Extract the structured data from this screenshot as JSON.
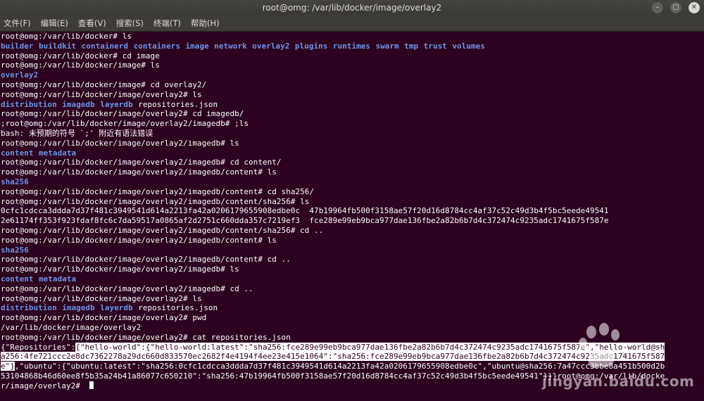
{
  "window": {
    "title": "root@omg: /var/lib/docker/image/overlay2"
  },
  "menu": [
    "文件(F)",
    "编辑(E)",
    "查看(V)",
    "搜索(S)",
    "终端(T)",
    "帮助(H)"
  ],
  "terminal": {
    "lines": [
      {
        "segments": [
          {
            "text": "root@omg:/var/lib/docker# ls"
          }
        ]
      },
      {
        "segments": [
          {
            "text": "builder",
            "type": "dir"
          },
          {
            "text": "buildkit",
            "type": "dir"
          },
          {
            "text": "containerd",
            "type": "dir"
          },
          {
            "text": "containers",
            "type": "dir"
          },
          {
            "text": "image",
            "type": "dir"
          },
          {
            "text": "network",
            "type": "dir"
          },
          {
            "text": "overlay2",
            "type": "dir"
          },
          {
            "text": "plugins",
            "type": "dir"
          },
          {
            "text": "runtimes",
            "type": "dir"
          },
          {
            "text": "swarm",
            "type": "dir"
          },
          {
            "text": "tmp",
            "type": "dir"
          },
          {
            "text": "trust",
            "type": "dir"
          },
          {
            "text": "volumes",
            "type": "dir"
          }
        ]
      },
      {
        "segments": [
          {
            "text": "root@omg:/var/lib/docker# cd image"
          }
        ]
      },
      {
        "segments": [
          {
            "text": "root@omg:/var/lib/docker/image# ls"
          }
        ]
      },
      {
        "segments": [
          {
            "text": "overlay2",
            "type": "dir"
          }
        ]
      },
      {
        "segments": [
          {
            "text": "root@omg:/var/lib/docker/image# cd overlay2/"
          }
        ]
      },
      {
        "segments": [
          {
            "text": "root@omg:/var/lib/docker/image/overlay2# ls"
          }
        ]
      },
      {
        "segments": [
          {
            "text": "distribution",
            "type": "dir"
          },
          {
            "text": "imagedb",
            "type": "dir"
          },
          {
            "text": "layerdb",
            "type": "dir"
          },
          {
            "text": "repositories.json"
          }
        ]
      },
      {
        "segments": [
          {
            "text": "root@omg:/var/lib/docker/image/overlay2# cd imagedb/"
          }
        ]
      },
      {
        "segments": [
          {
            "text": ";root@omg:/var/lib/docker/image/overlay2/imagedb# ;ls"
          }
        ]
      },
      {
        "segments": [
          {
            "text": "bash: 未预期的符号 `;' 附近有语法错误"
          }
        ]
      },
      {
        "segments": [
          {
            "text": "root@omg:/var/lib/docker/image/overlay2/imagedb# ls"
          }
        ]
      },
      {
        "segments": [
          {
            "text": "content",
            "type": "dir"
          },
          {
            "text": "metadata",
            "type": "dir"
          }
        ]
      },
      {
        "segments": [
          {
            "text": "root@omg:/var/lib/docker/image/overlay2/imagedb# cd content/"
          }
        ]
      },
      {
        "segments": [
          {
            "text": "root@omg:/var/lib/docker/image/overlay2/imagedb/content# ls"
          }
        ]
      },
      {
        "segments": [
          {
            "text": "sha256",
            "type": "dir"
          }
        ]
      },
      {
        "segments": [
          {
            "text": "root@omg:/var/lib/docker/image/overlay2/imagedb/content# cd sha256/"
          }
        ]
      },
      {
        "segments": [
          {
            "text": "root@omg:/var/lib/docker/image/overlay2/imagedb/content/sha256# ls"
          }
        ]
      },
      {
        "segments": [
          {
            "text": "0cfc1cdcca3ddda7d37f481c3949541d614a2213fa42a0206179655908edbe0c  47b19964fb500f3158ae57f20d16d8784cc4af37c52c49d3b4f5bc5eede49541"
          }
        ]
      },
      {
        "segments": [
          {
            "text": "2e61174ff353f923fdaf8fc6c7da59517a0865af2d2751c660dda357c7219ef3  fce289e99eb9bca977dae136fbe2a82b6b7d4c372474c9235adc1741675f587e"
          }
        ]
      },
      {
        "segments": [
          {
            "text": "root@omg:/var/lib/docker/image/overlay2/imagedb/content/sha256# cd .."
          }
        ]
      },
      {
        "segments": [
          {
            "text": "root@omg:/var/lib/docker/image/overlay2/imagedb/content# ls"
          }
        ]
      },
      {
        "segments": [
          {
            "text": "sha256",
            "type": "dir"
          }
        ]
      },
      {
        "segments": [
          {
            "text": "root@omg:/var/lib/docker/image/overlay2/imagedb/content# cd .."
          }
        ]
      },
      {
        "segments": [
          {
            "text": "root@omg:/var/lib/docker/image/overlay2/imagedb# ls"
          }
        ]
      },
      {
        "segments": [
          {
            "text": "content",
            "type": "dir"
          },
          {
            "text": "metadata",
            "type": "dir"
          }
        ]
      },
      {
        "segments": [
          {
            "text": "root@omg:/var/lib/docker/image/overlay2/imagedb# cd .."
          }
        ]
      },
      {
        "segments": [
          {
            "text": "root@omg:/var/lib/docker/image/overlay2# ls"
          }
        ]
      },
      {
        "segments": [
          {
            "text": "distribution",
            "type": "dir"
          },
          {
            "text": "imagedb",
            "type": "dir"
          },
          {
            "text": "layerdb",
            "type": "dir"
          },
          {
            "text": "repositories.json"
          }
        ]
      },
      {
        "segments": [
          {
            "text": "root@omg:/var/lib/docker/image/overlay2# pwd"
          }
        ]
      },
      {
        "segments": [
          {
            "text": "/var/lib/docker/image/overlay2"
          }
        ]
      },
      {
        "segments": [
          {
            "text": "root@omg:/var/lib/docker/image/overlay2# cat repositories.json"
          }
        ]
      },
      {
        "segments": [
          {
            "text": "{\"Repositories\":"
          },
          {
            "text": "{\"hello-world\":{\"hello-world:latest\":\"sha256:fce289e99eb9bca977dae136fbe2a82b6b7d4c372474c9235adc1741675f587e\",\"hello-world@sh",
            "type": "sel"
          }
        ]
      },
      {
        "segments": [
          {
            "text": "a256:4fe721ccc2e8dc7362278a29dc660d833570ec2682f4e4194f4ee23e415e1064\":\"sha256:fce289e99eb9bca977dae136fbe2a82b6b7d4c372474c9235adc1741675f587",
            "type": "sel"
          }
        ]
      },
      {
        "segments": [
          {
            "text": "e\"}",
            "type": "sel"
          },
          {
            "text": ",\"ubuntu\":{\"ubuntu:latest\":\"sha256:0cfc1cdcca3ddda7d37f481c3949541d614a2213fa42a0206179655908edbe0c\",\"ubuntu@sha256:7a47ccc3bbe8a451b500d2b"
          }
        ]
      },
      {
        "segments": [
          {
            "text": "53104868b46d60ee8f5b35a24b41a86077c650210\":\"sha256:47b19964fb500f3158ae57f20d16d8784cc4af37c52c49d3b4f5bc5eede49541\"}}}root@omg:/var/lib/docke"
          }
        ]
      },
      {
        "segments": [
          {
            "text": "r/image/overlay2# "
          }
        ],
        "cursor": true
      }
    ]
  },
  "watermark": {
    "text": "jingyan.baidu.com"
  }
}
